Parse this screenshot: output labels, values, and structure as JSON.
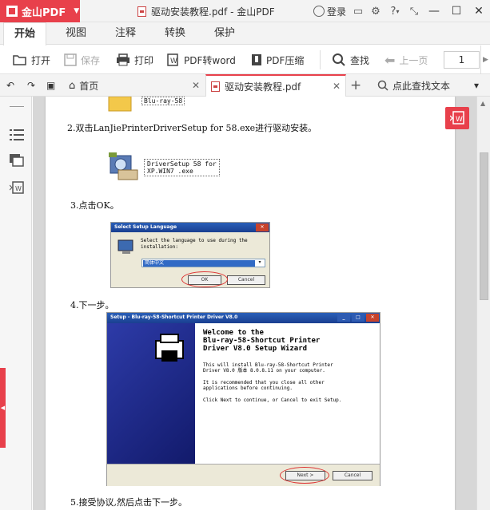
{
  "app": {
    "brand": "金山PDF",
    "window_title": "驱动安装教程.pdf - 金山PDF",
    "login": "登录"
  },
  "ribbon_tabs": [
    "开始",
    "视图",
    "注释",
    "转换",
    "保护"
  ],
  "toolbar": {
    "open": "打开",
    "save": "保存",
    "print": "打印",
    "pdf_to_word": "PDF转word",
    "pdf_compress": "PDF压缩",
    "find": "查找",
    "prev_page": "上一页",
    "page_number": "1"
  },
  "doc_tabs": {
    "home": "首页",
    "document": "驱动安装教程.pdf",
    "search": "点此查找文本"
  },
  "document": {
    "top_caption": "Blu-ray-58",
    "step2": "2.双击LanJiePrinterDriverSetup for 58.exe进行驱动安装。",
    "setup_file_line1": "DriverSetup 58 for",
    "setup_file_line2": "XP.WIN7 .exe",
    "step3": "3.点击OK。",
    "lang_dialog": {
      "title": "Select Setup Language",
      "text_line1": "Select the language to use during the",
      "text_line2": "installation:",
      "selected": "简体中文",
      "ok": "OK",
      "cancel": "Cancel"
    },
    "step4": "4.下一步。",
    "wizard": {
      "title": "Setup - Blu-ray-58-Shortcut Printer Driver V8.0",
      "heading_line1": "Welcome to the",
      "heading_line2": "Blu-ray-58-Shortcut Printer",
      "heading_line3": "Driver V8.0 Setup Wizard",
      "p1_line1": "This will install Blu-ray-58-Shortcut Printer",
      "p1_line2": "Driver V8.0 版本 8.0.8.11 on your computer.",
      "p2_line1": "It is recommended that you close all other",
      "p2_line2": "applications before continuing.",
      "p3": "Click Next to continue, or Cancel to exit Setup.",
      "next": "Next >",
      "cancel": "Cancel"
    },
    "step5": "5.接受协议,然后点击下一步。"
  },
  "colors": {
    "accent": "#e8404b",
    "wizard_blue": "#1f2a8f"
  }
}
